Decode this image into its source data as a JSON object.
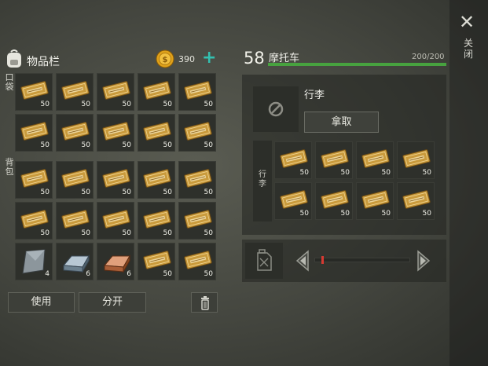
{
  "inventory": {
    "title": "物品栏",
    "coins": "390",
    "add_symbol": "+",
    "pocket_label": "口袋",
    "backpack_label": "背包",
    "pocket_slots": [
      {
        "item": "coupon-icon",
        "count": "50"
      },
      {
        "item": "coupon-icon",
        "count": "50"
      },
      {
        "item": "coupon-icon",
        "count": "50"
      },
      {
        "item": "coupon-icon",
        "count": "50"
      },
      {
        "item": "coupon-icon",
        "count": "50"
      },
      {
        "item": "coupon-icon",
        "count": "50"
      },
      {
        "item": "coupon-icon",
        "count": "50"
      },
      {
        "item": "coupon-icon",
        "count": "50"
      },
      {
        "item": "coupon-icon",
        "count": "50"
      },
      {
        "item": "coupon-icon",
        "count": "50"
      }
    ],
    "backpack_slots": [
      {
        "item": "coupon-icon",
        "count": "50"
      },
      {
        "item": "coupon-icon",
        "count": "50"
      },
      {
        "item": "coupon-icon",
        "count": "50"
      },
      {
        "item": "coupon-icon",
        "count": "50"
      },
      {
        "item": "coupon-icon",
        "count": "50"
      },
      {
        "item": "coupon-icon",
        "count": "50"
      },
      {
        "item": "coupon-icon",
        "count": "50"
      },
      {
        "item": "coupon-icon",
        "count": "50"
      },
      {
        "item": "coupon-icon",
        "count": "50"
      },
      {
        "item": "coupon-icon",
        "count": "50"
      },
      {
        "item": "steel-plate-icon",
        "count": "4"
      },
      {
        "item": "iron-bar-icon",
        "count": "6"
      },
      {
        "item": "copper-bar-icon",
        "count": "6"
      },
      {
        "item": "coupon-icon",
        "count": "50"
      },
      {
        "item": "coupon-icon",
        "count": "50"
      }
    ],
    "use_label": "使用",
    "split_label": "分开"
  },
  "vehicle": {
    "level": "58",
    "name": "摩托车",
    "health": "200/200",
    "health_fraction": 1.0,
    "health_color": "#47a23f",
    "luggage_title": "行李",
    "take_label": "拿取",
    "luggage_side_label": "行李",
    "luggage_slots": [
      {
        "item": "coupon-icon",
        "count": "50"
      },
      {
        "item": "coupon-icon",
        "count": "50"
      },
      {
        "item": "coupon-icon",
        "count": "50"
      },
      {
        "item": "coupon-icon",
        "count": "50"
      },
      {
        "item": "coupon-icon",
        "count": "50"
      },
      {
        "item": "coupon-icon",
        "count": "50"
      },
      {
        "item": "coupon-icon",
        "count": "50"
      },
      {
        "item": "coupon-icon",
        "count": "50"
      }
    ],
    "fuel_fraction": 0.07,
    "fuel_marker_color": "#d63a32"
  },
  "sidebar": {
    "close_symbol": "✕",
    "close_label": "关闭"
  },
  "colors": {
    "accent_teal": "#33c0b0",
    "coin_gold": "#e0a21a",
    "coupon_gold": "#c99a3c"
  }
}
